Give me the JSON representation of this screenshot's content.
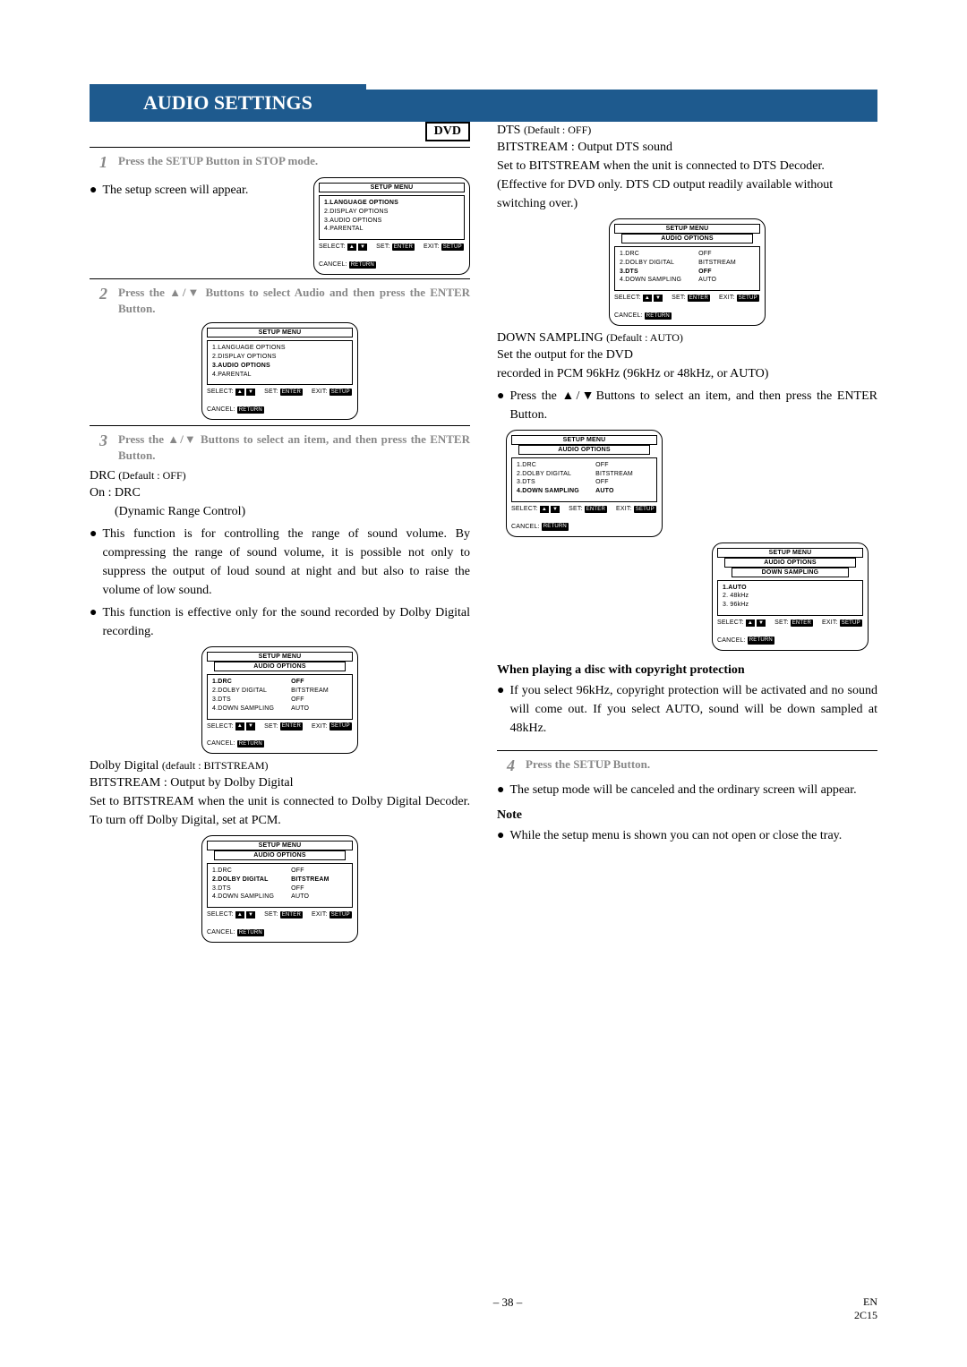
{
  "banner_title": "AUDIO SETTINGS",
  "dvd_badge": "DVD",
  "step1": {
    "num": "1",
    "text": "Press the SETUP Button in STOP mode."
  },
  "setup_appears": "The setup screen will appear.",
  "step2": {
    "num": "2",
    "text": "Press the ▲/▼ Buttons to select Audio and then press the ENTER Button."
  },
  "step3": {
    "num": "3",
    "text": "Press the ▲/▼ Buttons to select an item, and then press the ENTER Button."
  },
  "drc": {
    "title_main": "DRC ",
    "title_small": "(Default : OFF)",
    "on": "On : DRC",
    "sub": "(Dynamic Range Control)",
    "bullet1": "This function is for controlling the range of sound volume. By compressing the range of sound volume, it is possible not only to suppress the output of loud sound at night and but also to raise the volume of low sound.",
    "bullet2": "This function is effective only for the sound recorded by Dolby Digital recording."
  },
  "dolby": {
    "title_main": "Dolby Digital ",
    "title_small": "(default : BITSTREAM)",
    "line1": "BITSTREAM : Output by Dolby Digital",
    "line2": "Set to BITSTREAM when the unit is connected to Dolby Digital Decoder. To turn off Dolby Digital, set at PCM."
  },
  "dts": {
    "title_main": "DTS ",
    "title_small": "(Default : OFF)",
    "line1": "BITSTREAM : Output DTS sound",
    "line2": "Set to BITSTREAM when the unit is connected to DTS Decoder.",
    "line3": "(Effective for DVD only. DTS CD output readily available without switching over.)"
  },
  "ds": {
    "title_main": "DOWN SAMPLING ",
    "title_small": "(Default : AUTO)",
    "line1": "Set the output for the DVD",
    "line2": "recorded in PCM 96kHz (96kHz or 48kHz, or AUTO)",
    "bullet": "Press the ▲/▼Buttons to select an item, and then press the ENTER Button."
  },
  "copyright": {
    "hdr": "When playing a disc with copyright protection",
    "bullet": "If you select 96kHz, copyright protection will be activated and no sound will come out. If you select AUTO, sound will be down sampled at 48kHz."
  },
  "step4": {
    "num": "4",
    "text": "Press the SETUP Button."
  },
  "cancel_bullet": "The setup mode will be canceled and the ordinary screen will appear.",
  "note_hdr": "Note",
  "note_bullet": "While the setup menu is shown you can not open or close the tray.",
  "osd_labels": {
    "setup_menu": "SETUP MENU",
    "audio_options": "AUDIO OPTIONS",
    "down_sampling": "DOWN SAMPLING",
    "select": "SELECT:",
    "set": "SET:",
    "exit": "EXIT:",
    "cancel": "CANCEL:",
    "enter": "ENTER",
    "setup": "SETUP",
    "return": "RETURN"
  },
  "osd_main_menu": {
    "items": [
      {
        "label": "1.LANGUAGE OPTIONS",
        "bold": false
      },
      {
        "label": "2.DISPLAY OPTIONS",
        "bold": false
      },
      {
        "label": "3.AUDIO OPTIONS",
        "bold": false
      },
      {
        "label": "4.PARENTAL",
        "bold": false
      }
    ]
  },
  "osd_main_menu_sel": {
    "items": [
      {
        "label": "1.LANGUAGE OPTIONS",
        "bold": false
      },
      {
        "label": "2.DISPLAY OPTIONS",
        "bold": false
      },
      {
        "label": "3.AUDIO OPTIONS",
        "bold": true
      },
      {
        "label": "4.PARENTAL",
        "bold": false
      }
    ]
  },
  "osd_audio": {
    "rows": [
      {
        "l": "1.DRC",
        "r": "OFF",
        "bold": false
      },
      {
        "l": "2.DOLBY DIGITAL",
        "r": "BITSTREAM",
        "bold": false
      },
      {
        "l": "3.DTS",
        "r": "OFF",
        "bold": false
      },
      {
        "l": "4.DOWN SAMPLING",
        "r": "AUTO",
        "bold": false
      }
    ],
    "sel_drc": 0,
    "sel_dolby": 1,
    "sel_dts": 2,
    "sel_ds": 3
  },
  "osd_ds_sub": {
    "items": [
      {
        "label": "1.AUTO",
        "bold": true
      },
      {
        "label": "2. 48kHz",
        "bold": false
      },
      {
        "label": "3. 96kHz",
        "bold": false
      }
    ]
  },
  "footer": {
    "page": "– 38 –",
    "lang": "EN",
    "code": "2C15"
  }
}
